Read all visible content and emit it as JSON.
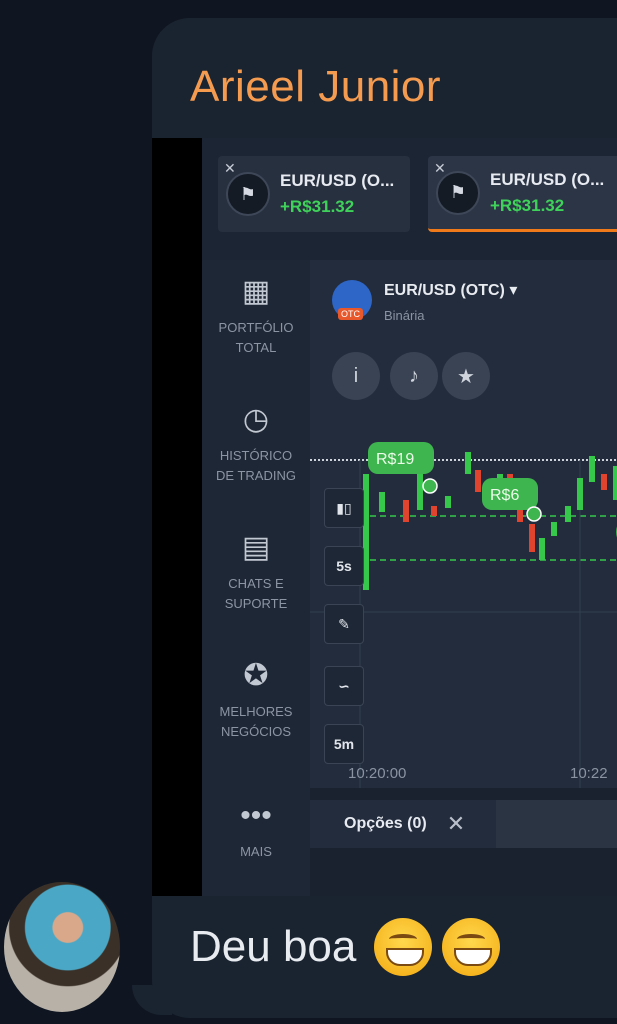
{
  "sender_name": "Arieel Junior",
  "message_text": "Deu boa",
  "emojis": [
    "grinning-face-emoji",
    "grinning-face-emoji"
  ],
  "screenshot": {
    "asset_tabs": [
      {
        "name": "EUR/USD (O...",
        "profit": "+R$31.32",
        "active": false
      },
      {
        "name": "EUR/USD (O...",
        "profit": "+R$31.32",
        "active": true
      }
    ],
    "sidebar": [
      {
        "icon": "briefcase-icon",
        "label_line1": "PORTFÓLIO",
        "label_line2": "TOTAL"
      },
      {
        "icon": "clock-icon",
        "label_line1": "HISTÓRICO",
        "label_line2": "DE TRADING"
      },
      {
        "icon": "chat-icon",
        "label_line1": "CHATS E",
        "label_line2": "SUPORTE"
      },
      {
        "icon": "medal-icon",
        "label_line1": "MELHORES",
        "label_line2": "NEGÓCIOS"
      },
      {
        "icon": "more-dots-icon",
        "label_line1": "MAIS",
        "label_line2": ""
      }
    ],
    "asset": {
      "title": "EUR/USD (OTC)",
      "subtitle": "Binária",
      "badge": "OTC"
    },
    "round_buttons": [
      "info-icon",
      "bell-icon",
      "star-icon"
    ],
    "tools": [
      "candles-icon",
      "5s",
      "pencil-icon",
      "indicator-icon",
      "5m"
    ],
    "trade_labels": [
      "R$19",
      "R$6"
    ],
    "time_labels": [
      "10:20:00",
      "10:22"
    ],
    "options_tab": "Opções (0)",
    "colors": {
      "up": "#36c84b",
      "down": "#e0442f",
      "accent": "#f07a1a",
      "sender": "#f59b4f"
    }
  }
}
